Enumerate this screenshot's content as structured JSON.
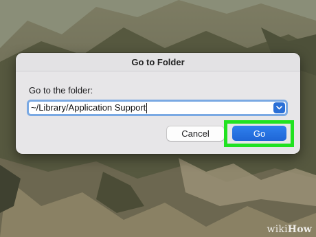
{
  "dialog": {
    "title": "Go to Folder",
    "prompt_label": "Go to the folder:",
    "path_value": "~/Library/Application Support",
    "cancel_label": "Cancel",
    "go_label": "Go"
  },
  "watermark": {
    "wiki": "wiki",
    "how": "How"
  },
  "colors": {
    "accent": "#2a6fd6",
    "highlight": "#21e221",
    "focus_ring": "#7aa9e3",
    "dialog_bg": "#e7e6e8"
  },
  "icons": {
    "dropdown": "chevron-down-icon"
  }
}
